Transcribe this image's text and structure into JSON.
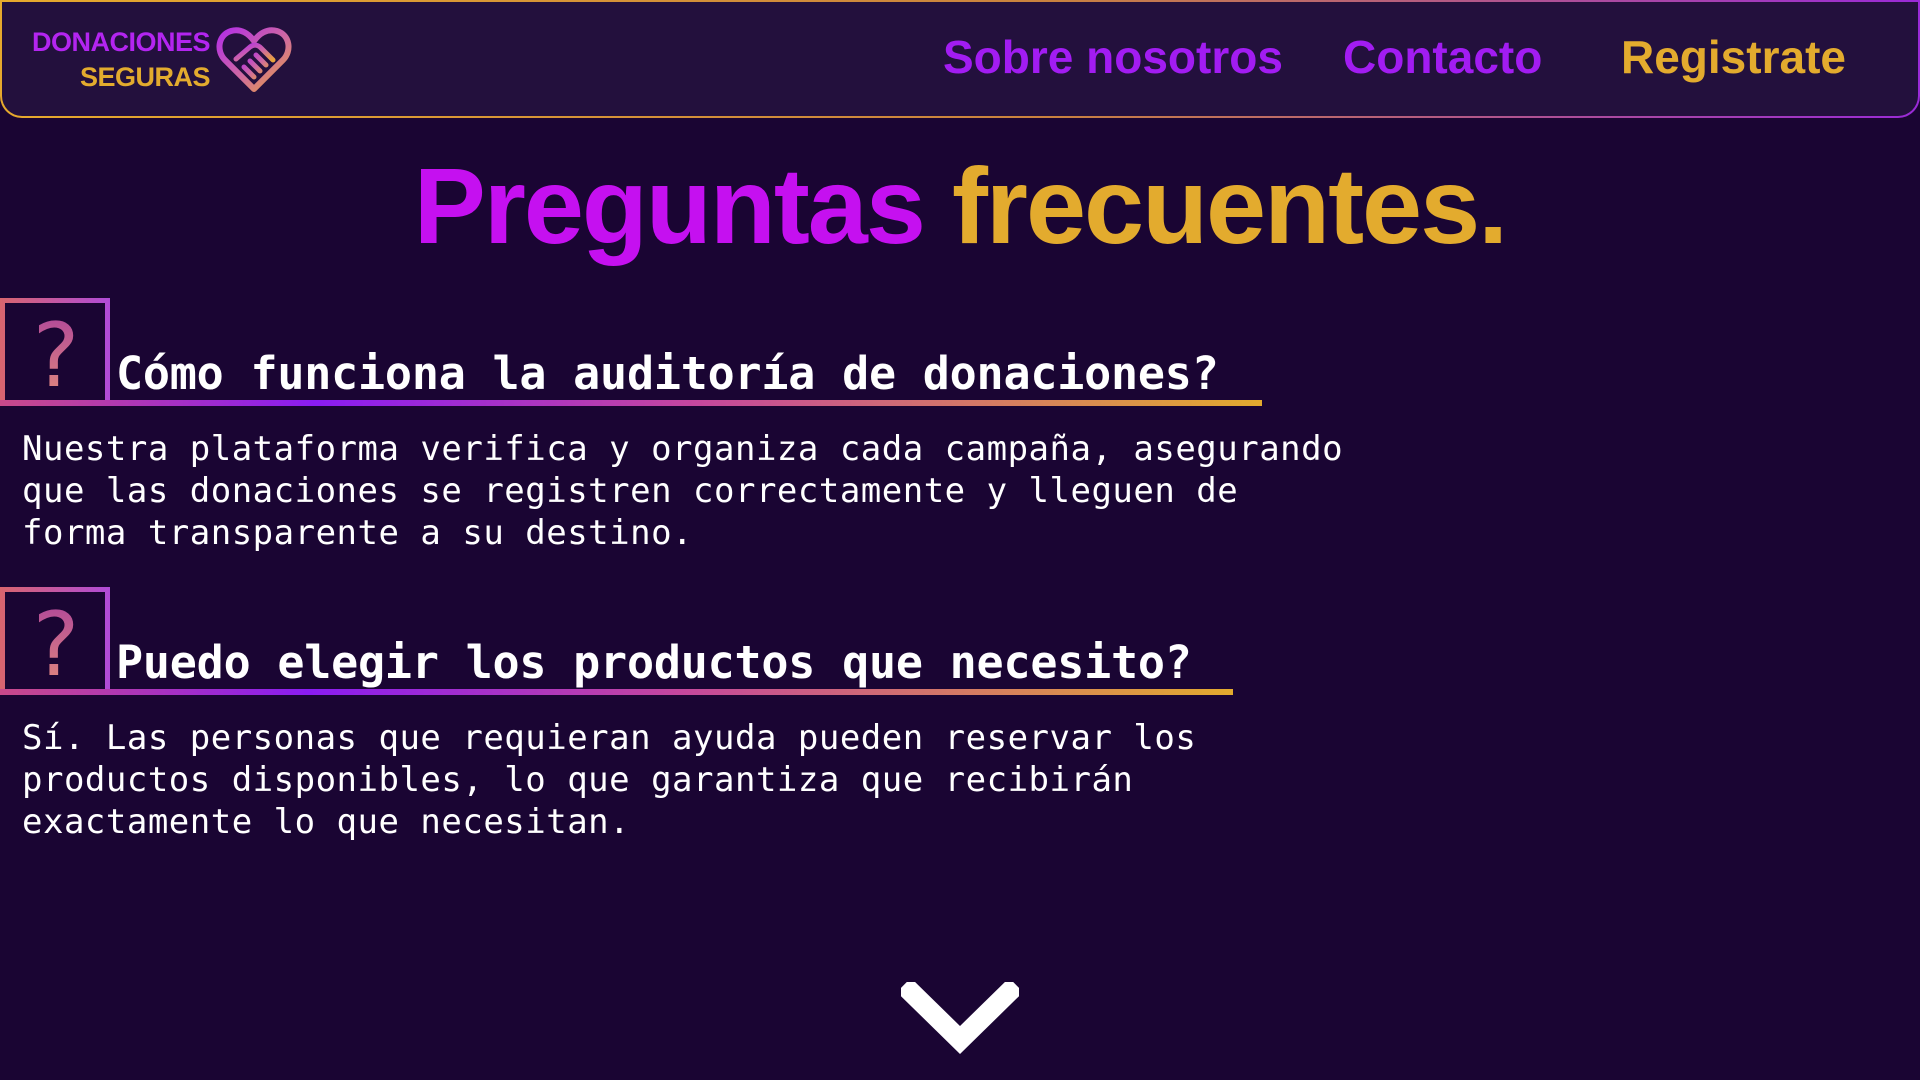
{
  "header": {
    "logo": {
      "line1": "DONACIONES",
      "line2": "SEGURAS",
      "icon": "heart-handshake-icon"
    },
    "nav": {
      "about": "Sobre nosotros",
      "contact": "Contacto",
      "register": "Registrate"
    }
  },
  "title": {
    "part1": "Preguntas",
    "part2": "frecuentes."
  },
  "faq": [
    {
      "icon": "question-mark-icon",
      "question": "Cómo funciona la auditoría de donaciones?",
      "answer_lines": [
        "Nuestra plataforma verifica y organiza cada campaña, asegurando",
        "que las donaciones se registren correctamente y lleguen de",
        "forma transparente a su destino."
      ]
    },
    {
      "icon": "question-mark-icon",
      "question": "Puedo elegir los productos que necesito?",
      "answer_lines": [
        "Sí. Las personas que requieran ayuda pueden reservar los",
        "productos disponibles, lo que garantiza que recibirán",
        "exactamente lo que necesitan."
      ]
    }
  ],
  "scroll_icon": "chevron-down-icon",
  "colors": {
    "background": "#1a0533",
    "header_bg": "#23103d",
    "purple": "#a21cf2",
    "magenta": "#c510f0",
    "gold": "#e3ab2e",
    "text": "#ffffff"
  }
}
